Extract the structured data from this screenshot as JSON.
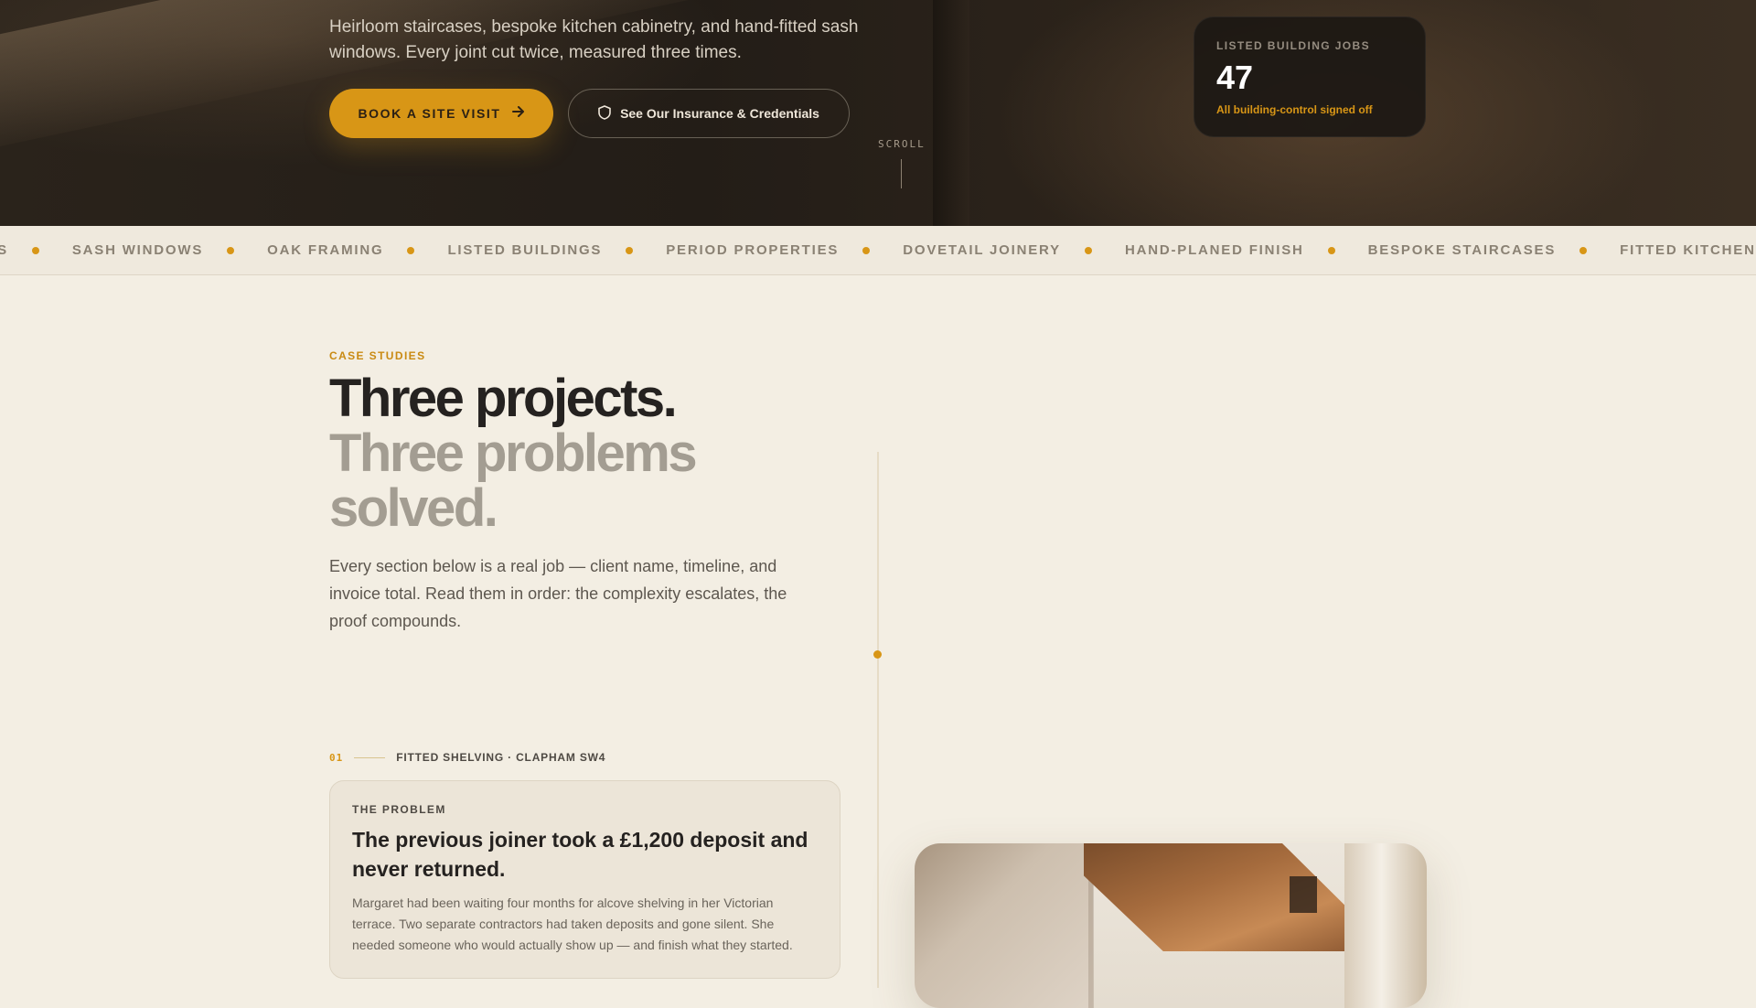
{
  "hero": {
    "subtitle": "Heirloom staircases, bespoke kitchen cabinetry, and hand-fitted sash windows. Every joint cut twice, measured three times.",
    "primary_cta": "BOOK A SITE VISIT",
    "primary_cta_icon": "arrow-right-icon",
    "secondary_cta": "See Our Insurance & Credentials",
    "secondary_cta_icon": "shield-icon",
    "scroll_label": "SCROLL",
    "stat": {
      "label": "LISTED BUILDING JOBS",
      "value": "47",
      "note": "All building-control signed off"
    }
  },
  "ticker": {
    "items": [
      "HENS",
      "SASH WINDOWS",
      "OAK FRAMING",
      "LISTED BUILDINGS",
      "PERIOD PROPERTIES",
      "DOVETAIL JOINERY",
      "HAND-PLANED FINISH",
      "BESPOKE STAIRCASES",
      "FITTED KITCHENS"
    ]
  },
  "case_studies": {
    "eyebrow": "CASE STUDIES",
    "heading_line1": "Three projects.",
    "heading_line2": "Three problems solved.",
    "lede": "Every section below is a real job — client name, timeline, and invoice total. Read them in order: the complexity escalates, the proof compounds.",
    "cases": [
      {
        "number": "01",
        "location": "FITTED SHELVING · CLAPHAM SW4",
        "problem_label": "THE PROBLEM",
        "problem_title": "The previous joiner took a £1,200 deposit and never returned.",
        "problem_body": "Margaret had been waiting four months for alcove shelving in her Victorian terrace. Two separate contractors had taken deposits and gone silent. She needed someone who would actually show up — and finish what they started."
      }
    ]
  },
  "colors": {
    "accent": "#d89616",
    "hero_bg": "#231d17",
    "page_bg": "#f3eee3",
    "text_dark": "#252220",
    "text_muted": "#a39d92"
  }
}
